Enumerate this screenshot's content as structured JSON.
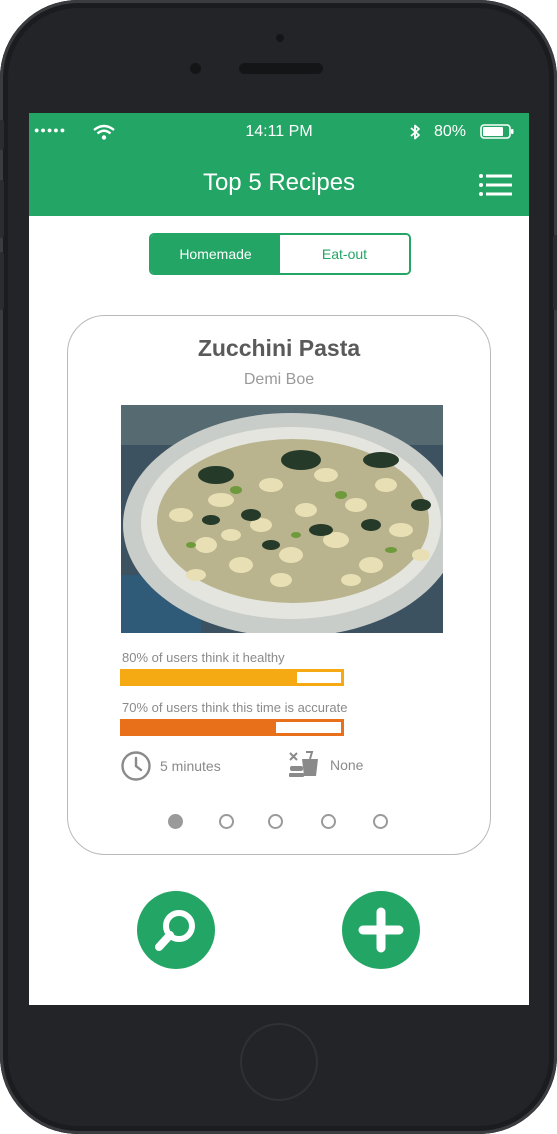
{
  "status_bar": {
    "signal": "●●●●●",
    "time": "14:11 PM",
    "battery": "80%",
    "battery_level": 0.8
  },
  "header": {
    "title": "Top 5 Recipes"
  },
  "tabs": [
    {
      "label": "Homemade",
      "active": true
    },
    {
      "label": "Eat-out",
      "active": false
    }
  ],
  "recipe": {
    "name": "Zucchini Pasta",
    "author": "Demi Boe",
    "stats": [
      {
        "label": "80% of users think it healthy",
        "value": 0.8,
        "color": "#f5aa13"
      },
      {
        "label": "70% of users think this time is accurate",
        "value": 0.7,
        "color": "#e8701a"
      }
    ],
    "time": "5 minutes",
    "diet": "None"
  },
  "pager": {
    "count": 5,
    "active": 0
  },
  "colors": {
    "brand": "#23a565"
  }
}
